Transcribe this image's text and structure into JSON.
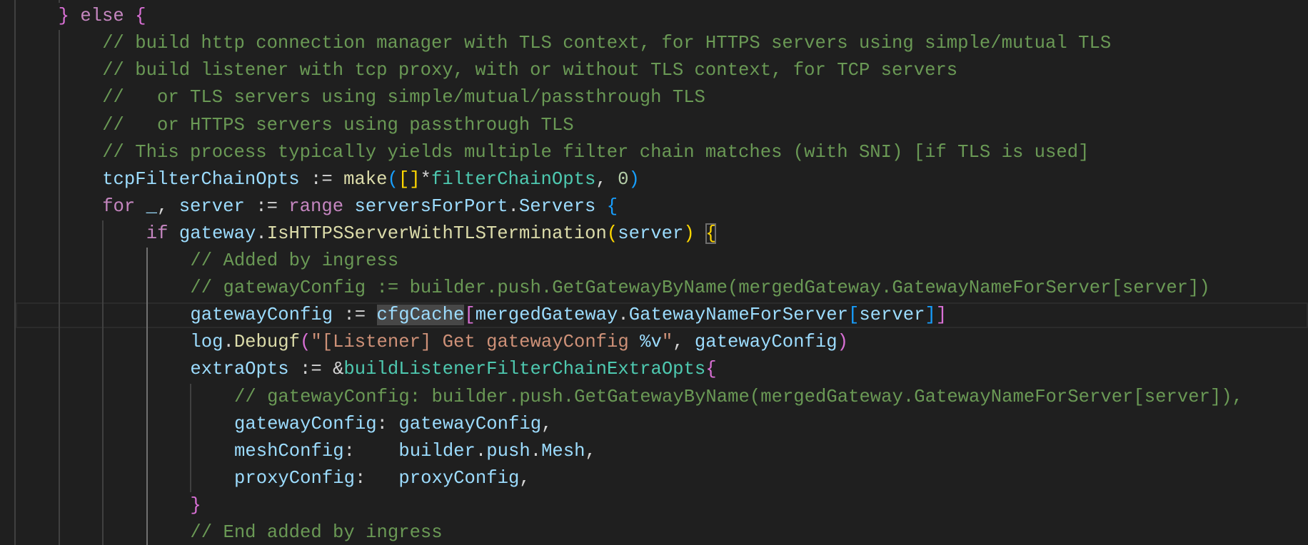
{
  "editor": {
    "language": "go",
    "colors": {
      "background": "#1f1f1f",
      "comment": "#6a9955",
      "variable": "#9cdcfe",
      "keyword": "#c586c0",
      "function": "#dcdcaa",
      "type": "#4ec9b0",
      "string": "#ce9178"
    },
    "current_line": 12,
    "lines": [
      {
        "indent": 8,
        "tokens": [
          [
            "}",
            "by"
          ],
          [
            ")",
            "bb"
          ]
        ]
      },
      {
        "indent": 4,
        "tokens": [
          [
            "}",
            "bp"
          ],
          [
            " ",
            "o"
          ],
          [
            "else",
            "k"
          ],
          [
            " ",
            "o"
          ],
          [
            "{",
            "bp"
          ]
        ]
      },
      {
        "indent": 8,
        "tokens": [
          [
            "// build http connection manager with TLS context, for HTTPS servers using simple/mutual TLS",
            "c"
          ]
        ]
      },
      {
        "indent": 8,
        "tokens": [
          [
            "// build listener with tcp proxy, with or without TLS context, for TCP servers",
            "c"
          ]
        ]
      },
      {
        "indent": 8,
        "tokens": [
          [
            "//   or TLS servers using simple/mutual/passthrough TLS",
            "c"
          ]
        ]
      },
      {
        "indent": 8,
        "tokens": [
          [
            "//   or HTTPS servers using passthrough TLS",
            "c"
          ]
        ]
      },
      {
        "indent": 8,
        "tokens": [
          [
            "// This process typically yields multiple filter chain matches (with SNI) [if TLS is used]",
            "c"
          ]
        ]
      },
      {
        "indent": 8,
        "tokens": [
          [
            "tcpFilterChainOpts",
            "v"
          ],
          [
            " := ",
            "o"
          ],
          [
            "make",
            "f"
          ],
          [
            "(",
            "bb"
          ],
          [
            "[",
            "by"
          ],
          [
            "]",
            "by"
          ],
          [
            "*",
            "o"
          ],
          [
            "filterChainOpts",
            "t"
          ],
          [
            ", ",
            "o"
          ],
          [
            "0",
            "n"
          ],
          [
            ")",
            "bb"
          ]
        ]
      },
      {
        "indent": 8,
        "tokens": [
          [
            "for",
            "k"
          ],
          [
            " ",
            "o"
          ],
          [
            "_",
            "v"
          ],
          [
            ", ",
            "o"
          ],
          [
            "server",
            "v"
          ],
          [
            " := ",
            "o"
          ],
          [
            "range",
            "k"
          ],
          [
            " ",
            "o"
          ],
          [
            "serversForPort",
            "v"
          ],
          [
            ".",
            "o"
          ],
          [
            "Servers",
            "v"
          ],
          [
            " ",
            "o"
          ],
          [
            "{",
            "bb"
          ]
        ]
      },
      {
        "indent": 12,
        "tokens": [
          [
            "if",
            "k"
          ],
          [
            " ",
            "o"
          ],
          [
            "gateway",
            "v"
          ],
          [
            ".",
            "o"
          ],
          [
            "IsHTTPSServerWithTLSTermination",
            "f"
          ],
          [
            "(",
            "by"
          ],
          [
            "server",
            "v"
          ],
          [
            ")",
            "by"
          ],
          [
            " ",
            "o"
          ],
          [
            "{",
            "match"
          ]
        ]
      },
      {
        "indent": 16,
        "tokens": [
          [
            "// Added by ingress",
            "c"
          ]
        ]
      },
      {
        "indent": 16,
        "tokens": [
          [
            "// gatewayConfig := builder.push.GetGatewayByName(mergedGateway.GatewayNameForServer[server])",
            "c"
          ]
        ]
      },
      {
        "indent": 16,
        "tokens": [
          [
            "gatewayConfig",
            "v"
          ],
          [
            " := ",
            "o"
          ],
          [
            "cfgCache",
            "sel"
          ],
          [
            "[",
            "bp"
          ],
          [
            "mergedGateway",
            "v"
          ],
          [
            ".",
            "o"
          ],
          [
            "GatewayNameForServer",
            "v"
          ],
          [
            "[",
            "bb"
          ],
          [
            "server",
            "v"
          ],
          [
            "]",
            "bb"
          ],
          [
            "]",
            "bp"
          ]
        ]
      },
      {
        "indent": 16,
        "tokens": [
          [
            "log",
            "v"
          ],
          [
            ".",
            "o"
          ],
          [
            "Debugf",
            "f"
          ],
          [
            "(",
            "bp"
          ],
          [
            "\"[Listener] Get gatewayConfig ",
            "s"
          ],
          [
            "%v",
            "v"
          ],
          [
            "\"",
            "s"
          ],
          [
            ", ",
            "o"
          ],
          [
            "gatewayConfig",
            "v"
          ],
          [
            ")",
            "bp"
          ]
        ]
      },
      {
        "indent": 16,
        "tokens": [
          [
            "extraOpts",
            "v"
          ],
          [
            " := ",
            "o"
          ],
          [
            "&",
            "o"
          ],
          [
            "buildListenerFilterChainExtraOpts",
            "t"
          ],
          [
            "{",
            "bp"
          ]
        ]
      },
      {
        "indent": 20,
        "tokens": [
          [
            "// gatewayConfig: builder.push.GetGatewayByName(mergedGateway.GatewayNameForServer[server]),",
            "c"
          ]
        ]
      },
      {
        "indent": 20,
        "tokens": [
          [
            "gatewayConfig",
            "v"
          ],
          [
            ": ",
            "o"
          ],
          [
            "gatewayConfig",
            "v"
          ],
          [
            ",",
            "o"
          ]
        ]
      },
      {
        "indent": 20,
        "tokens": [
          [
            "meshConfig",
            "v"
          ],
          [
            ":    ",
            "o"
          ],
          [
            "builder",
            "v"
          ],
          [
            ".",
            "o"
          ],
          [
            "push",
            "v"
          ],
          [
            ".",
            "o"
          ],
          [
            "Mesh",
            "v"
          ],
          [
            ",",
            "o"
          ]
        ]
      },
      {
        "indent": 20,
        "tokens": [
          [
            "proxyConfig",
            "v"
          ],
          [
            ":   ",
            "o"
          ],
          [
            "proxyConfig",
            "v"
          ],
          [
            ",",
            "o"
          ]
        ]
      },
      {
        "indent": 16,
        "tokens": [
          [
            "}",
            "bp"
          ]
        ]
      },
      {
        "indent": 16,
        "tokens": [
          [
            "// End added by ingress",
            "c"
          ]
        ]
      }
    ]
  }
}
